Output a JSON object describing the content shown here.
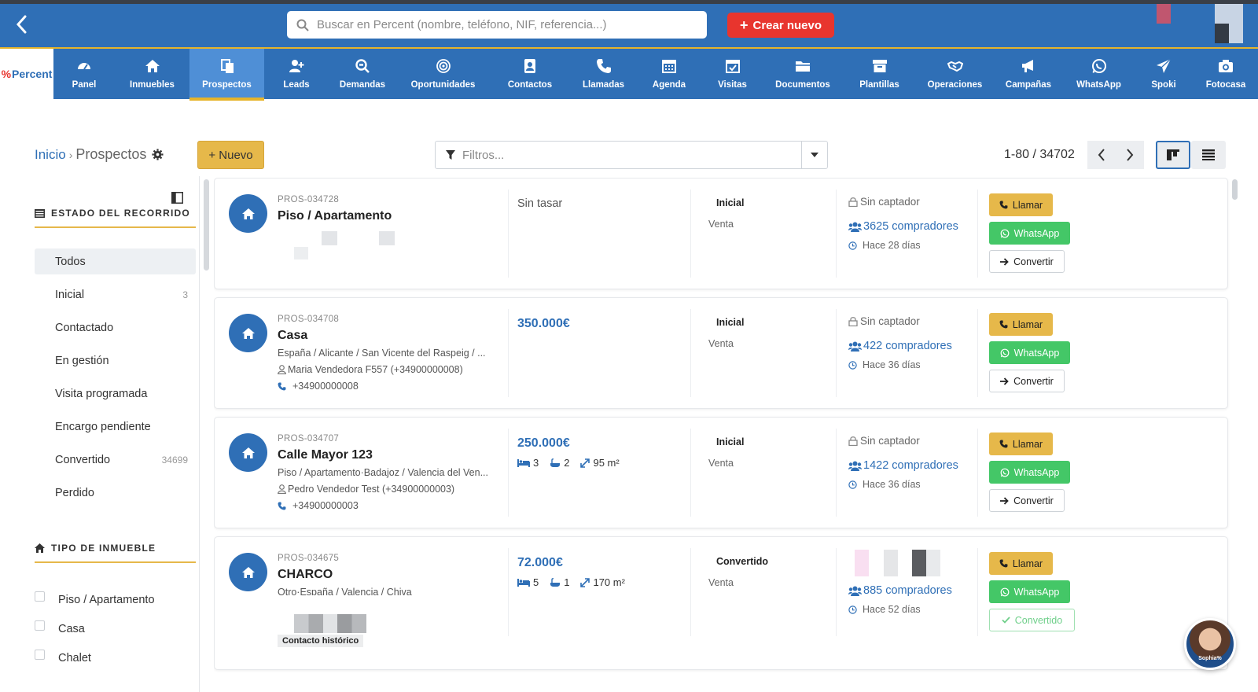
{
  "topbar": {
    "search_placeholder": "Buscar en Percent (nombre, teléfono, NIF, referencia...)",
    "create_label": "Crear nuevo"
  },
  "logo": {
    "mark": "%",
    "text": "Percent"
  },
  "nav": [
    {
      "label": "Panel",
      "icon": "dashboard-icon"
    },
    {
      "label": "Inmuebles",
      "icon": "home-icon"
    },
    {
      "label": "Prospectos",
      "icon": "documents-icon",
      "active": true
    },
    {
      "label": "Leads",
      "icon": "user-plus-icon"
    },
    {
      "label": "Demandas",
      "icon": "search-icon"
    },
    {
      "label": "Oportunidades",
      "icon": "target-icon"
    },
    {
      "label": "Contactos",
      "icon": "contact-icon"
    },
    {
      "label": "Llamadas",
      "icon": "phone-icon"
    },
    {
      "label": "Agenda",
      "icon": "calendar-icon"
    },
    {
      "label": "Visitas",
      "icon": "calendar-check-icon"
    },
    {
      "label": "Documentos",
      "icon": "folder-icon"
    },
    {
      "label": "Plantillas",
      "icon": "archive-icon"
    },
    {
      "label": "Operaciones",
      "icon": "handshake-icon"
    },
    {
      "label": "Campañas",
      "icon": "megaphone-icon"
    },
    {
      "label": "WhatsApp",
      "icon": "whatsapp-icon"
    },
    {
      "label": "Spoki",
      "icon": "send-icon"
    },
    {
      "label": "Fotocasa",
      "icon": "camera-icon"
    }
  ],
  "breadcrumb": {
    "home": "Inicio",
    "sep": "›",
    "current": "Prospectos"
  },
  "toolbar": {
    "new_label": "+ Nuevo",
    "filter_placeholder": "Filtros...",
    "pager": "1-80 / 34702"
  },
  "sidebar": {
    "status_heading": "ESTADO DEL RECORRIDO",
    "status_items": [
      {
        "label": "Todos",
        "count": "",
        "active": true
      },
      {
        "label": "Inicial",
        "count": "3"
      },
      {
        "label": "Contactado",
        "count": ""
      },
      {
        "label": "En gestión",
        "count": ""
      },
      {
        "label": "Visita programada",
        "count": ""
      },
      {
        "label": "Encargo pendiente",
        "count": ""
      },
      {
        "label": "Convertido",
        "count": "34699"
      },
      {
        "label": "Perdido",
        "count": ""
      }
    ],
    "type_heading": "TIPO DE INMUEBLE",
    "type_items": [
      "Piso / Apartamento",
      "Casa",
      "Chalet"
    ]
  },
  "cards": [
    {
      "ref": "PROS-034728",
      "title": "Piso / Apartamento",
      "addr": "",
      "owner": "",
      "phone": "",
      "price": "",
      "no_price": "Sin tasar",
      "specs": null,
      "status": "Inicial",
      "operation": "Venta",
      "captador": "Sin captador",
      "buyers": "3625 compradores",
      "ago": "Hace 28 días",
      "converted": false
    },
    {
      "ref": "PROS-034708",
      "title": "Casa",
      "addr": "España / Alicante / San Vicente del Raspeig / ...",
      "owner": "Maria Vendedora F557 (+34900000008)",
      "phone": "+34900000008",
      "price": "350.000€",
      "no_price": "",
      "specs": null,
      "status": "Inicial",
      "operation": "Venta",
      "captador": "Sin captador",
      "buyers": "422 compradores",
      "ago": "Hace 36 días",
      "converted": false
    },
    {
      "ref": "PROS-034707",
      "title": "Calle Mayor 123",
      "addr": "Piso / Apartamento·Badajoz / Valencia del Ven...",
      "owner": "Pedro Vendedor Test (+34900000003)",
      "phone": "+34900000003",
      "price": "250.000€",
      "no_price": "",
      "specs": {
        "beds": "3",
        "baths": "2",
        "area": "95 m²"
      },
      "status": "Inicial",
      "operation": "Venta",
      "captador": "Sin captador",
      "buyers": "1422 compradores",
      "ago": "Hace 36 días",
      "converted": false
    },
    {
      "ref": "PROS-034675",
      "title": "CHARCO",
      "addr": "Otro·España / Valencia / Chiva",
      "owner": "",
      "phone": "",
      "price": "72.000€",
      "no_price": "",
      "specs": {
        "beds": "5",
        "baths": "1",
        "area": "170 m²"
      },
      "status": "Convertido",
      "operation": "Venta",
      "captador": "",
      "buyers": "885 compradores",
      "ago": "Hace 52 días",
      "converted": true,
      "badge": "Contacto histórico"
    }
  ],
  "actions": {
    "call": "Llamar",
    "whatsapp": "WhatsApp",
    "convert": "Convertir",
    "converted": "Convertido"
  },
  "chat": {
    "name": "Sophia%"
  }
}
